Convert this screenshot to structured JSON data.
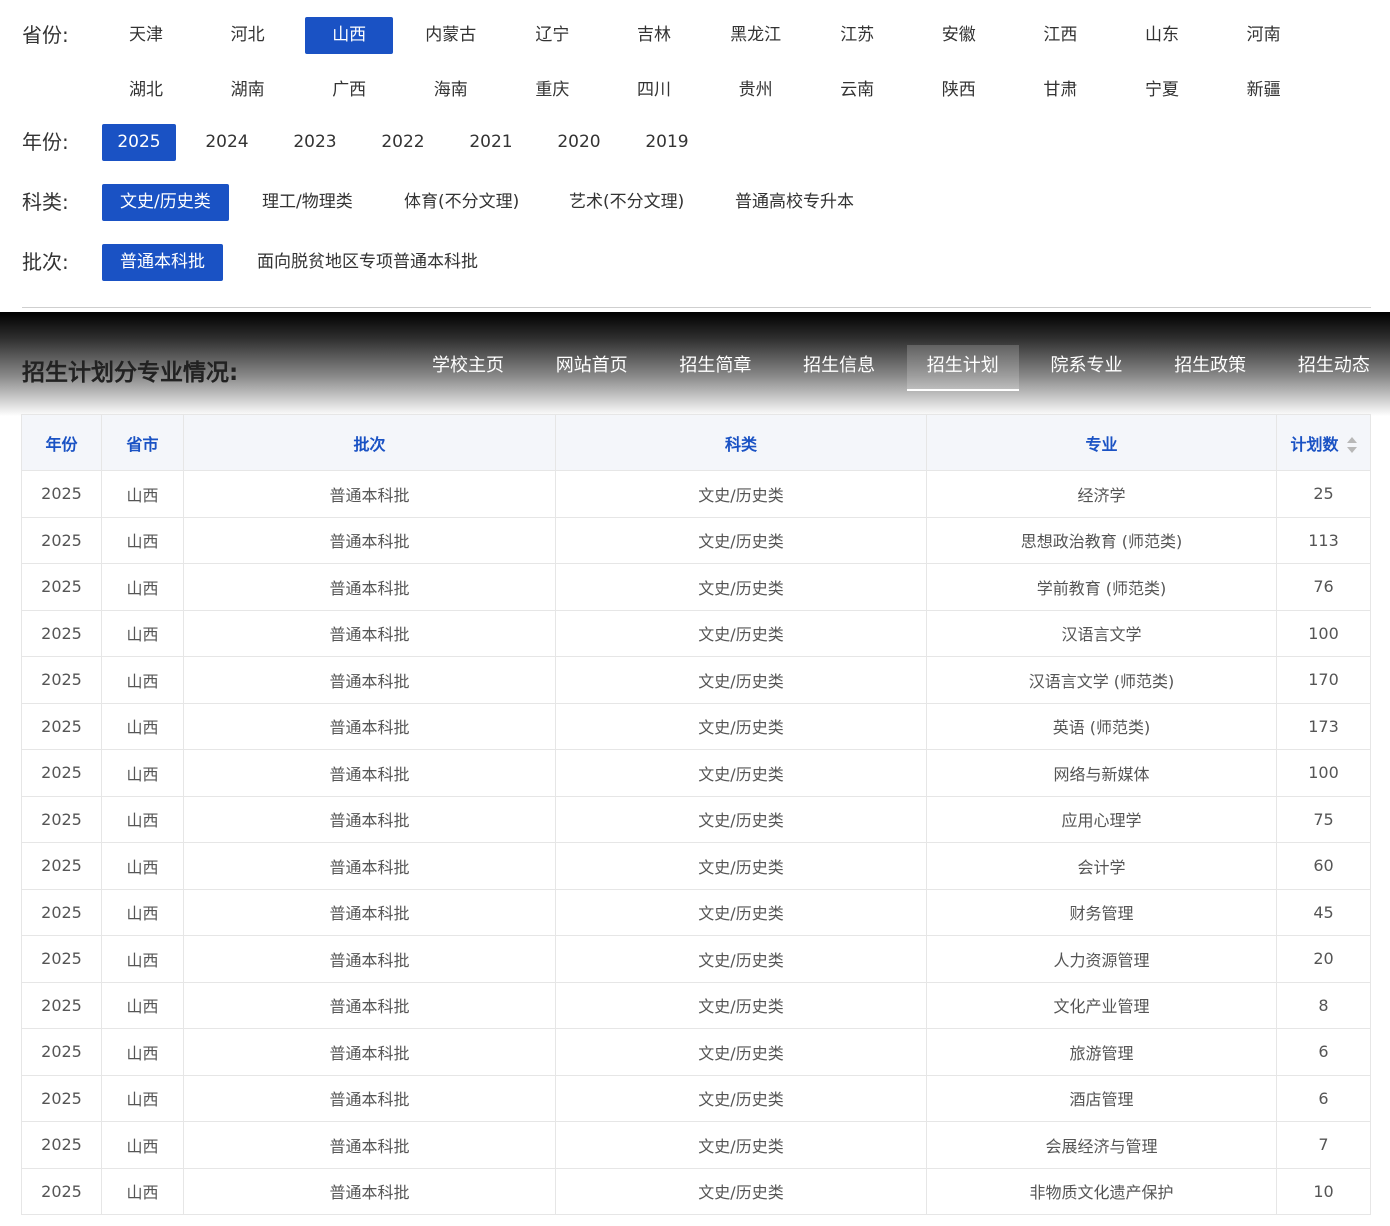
{
  "filters": {
    "province": {
      "label": "省份:",
      "options": [
        "天津",
        "河北",
        "山西",
        "内蒙古",
        "辽宁",
        "吉林",
        "黑龙江",
        "江苏",
        "安徽",
        "江西",
        "山东",
        "河南",
        "湖北",
        "湖南",
        "广西",
        "海南",
        "重庆",
        "四川",
        "贵州",
        "云南",
        "陕西",
        "甘肃",
        "宁夏",
        "新疆"
      ],
      "selected": "山西"
    },
    "year": {
      "label": "年份:",
      "options": [
        "2025",
        "2024",
        "2023",
        "2022",
        "2021",
        "2020",
        "2019"
      ],
      "selected": "2025"
    },
    "category": {
      "label": "科类:",
      "options": [
        "文史/历史类",
        "理工/物理类",
        "体育(不分文理)",
        "艺术(不分文理)",
        "普通高校专升本"
      ],
      "selected": "文史/历史类"
    },
    "batch": {
      "label": "批次:",
      "options": [
        "普通本科批",
        "面向脱贫地区专项普通本科批"
      ],
      "selected": "普通本科批"
    }
  },
  "banner": {
    "title": "招生计划分专业情况:",
    "nav": [
      "学校主页",
      "网站首页",
      "招生简章",
      "招生信息",
      "招生计划",
      "院系专业",
      "招生政策",
      "招生动态"
    ],
    "active_nav": "招生计划"
  },
  "table": {
    "columns": [
      "年份",
      "省市",
      "批次",
      "科类",
      "专业",
      "计划数"
    ],
    "rows": [
      [
        "2025",
        "山西",
        "普通本科批",
        "文史/历史类",
        "经济学",
        "25"
      ],
      [
        "2025",
        "山西",
        "普通本科批",
        "文史/历史类",
        "思想政治教育 (师范类)",
        "113"
      ],
      [
        "2025",
        "山西",
        "普通本科批",
        "文史/历史类",
        "学前教育 (师范类)",
        "76"
      ],
      [
        "2025",
        "山西",
        "普通本科批",
        "文史/历史类",
        "汉语言文学",
        "100"
      ],
      [
        "2025",
        "山西",
        "普通本科批",
        "文史/历史类",
        "汉语言文学 (师范类)",
        "170"
      ],
      [
        "2025",
        "山西",
        "普通本科批",
        "文史/历史类",
        "英语 (师范类)",
        "173"
      ],
      [
        "2025",
        "山西",
        "普通本科批",
        "文史/历史类",
        "网络与新媒体",
        "100"
      ],
      [
        "2025",
        "山西",
        "普通本科批",
        "文史/历史类",
        "应用心理学",
        "75"
      ],
      [
        "2025",
        "山西",
        "普通本科批",
        "文史/历史类",
        "会计学",
        "60"
      ],
      [
        "2025",
        "山西",
        "普通本科批",
        "文史/历史类",
        "财务管理",
        "45"
      ],
      [
        "2025",
        "山西",
        "普通本科批",
        "文史/历史类",
        "人力资源管理",
        "20"
      ],
      [
        "2025",
        "山西",
        "普通本科批",
        "文史/历史类",
        "文化产业管理",
        "8"
      ],
      [
        "2025",
        "山西",
        "普通本科批",
        "文史/历史类",
        "旅游管理",
        "6"
      ],
      [
        "2025",
        "山西",
        "普通本科批",
        "文史/历史类",
        "酒店管理",
        "6"
      ],
      [
        "2025",
        "山西",
        "普通本科批",
        "文史/历史类",
        "会展经济与管理",
        "7"
      ],
      [
        "2025",
        "山西",
        "普通本科批",
        "文史/历史类",
        "非物质文化遗产保护",
        "10"
      ]
    ]
  },
  "colors": {
    "accent": "#1a52c4",
    "header_bg": "#f4f6fa",
    "text": "#333333"
  }
}
